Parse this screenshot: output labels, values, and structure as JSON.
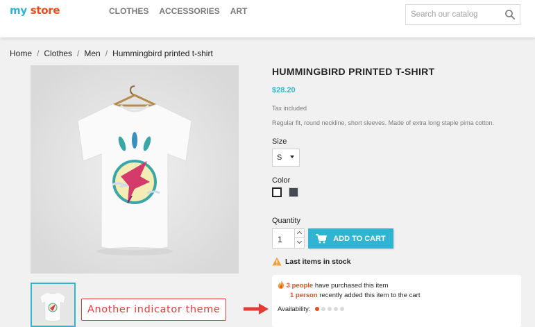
{
  "header": {
    "logo_part1": "my",
    "logo_part2": "store",
    "nav": [
      "CLOTHES",
      "ACCESSORIES",
      "ART"
    ],
    "search_placeholder": "Search our catalog"
  },
  "breadcrumb": [
    "Home",
    "Clothes",
    "Men",
    "Hummingbird printed t-shirt"
  ],
  "product": {
    "title": "HUMMINGBIRD PRINTED T-SHIRT",
    "price": "$28.20",
    "tax": "Tax included",
    "description": "Regular fit, round neckline, short sleeves. Made of extra long staple pima cotton.",
    "size_label": "Size",
    "size_value": "S",
    "color_label": "Color",
    "colors": [
      "#ffffff",
      "#434a54"
    ],
    "quantity_label": "Quantity",
    "quantity_value": "1",
    "add_to_cart": "ADD TO CART",
    "stock_status": "Last items in stock"
  },
  "indicator": {
    "people_count": "3 people",
    "people_text": "have purchased this item",
    "person_count": "1 person",
    "person_text": "recently added this item to the cart",
    "availability_label": "Availability:",
    "availability_level": 1,
    "availability_max": 5
  },
  "annotation": "Another indicator theme",
  "colors": {
    "accent": "#2fb5d2",
    "highlight": "#e84e1b",
    "annotation": "#e53935"
  }
}
